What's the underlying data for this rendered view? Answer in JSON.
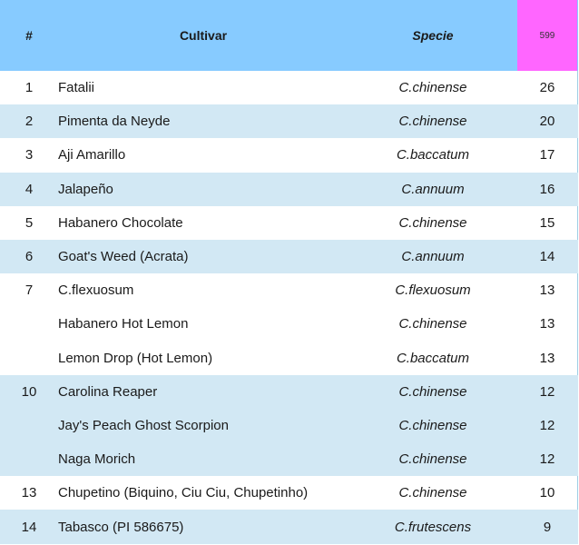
{
  "header": {
    "rank": "#",
    "cultivar": "Cultivar",
    "species": "Specie",
    "total": "599"
  },
  "rows": [
    {
      "rank": "1",
      "cultivar": "Fatalii",
      "species": "C.chinense",
      "count": "26",
      "shaded": false
    },
    {
      "rank": "2",
      "cultivar": "Pimenta da Neyde",
      "species": "C.chinense",
      "count": "20",
      "shaded": true
    },
    {
      "rank": "3",
      "cultivar": "Aji Amarillo",
      "species": "C.baccatum",
      "count": "17",
      "shaded": false
    },
    {
      "rank": "4",
      "cultivar": "Jalapeño",
      "species": "C.annuum",
      "count": "16",
      "shaded": true
    },
    {
      "rank": "5",
      "cultivar": "Habanero Chocolate",
      "species": "C.chinense",
      "count": "15",
      "shaded": false
    },
    {
      "rank": "6",
      "cultivar": "Goat's Weed (Acrata)",
      "species": "C.annuum",
      "count": "14",
      "shaded": true
    },
    {
      "rank": "7",
      "cultivar": "C.flexuosum",
      "species": "C.flexuosum",
      "count": "13",
      "shaded": false
    },
    {
      "rank": "",
      "cultivar": "Habanero Hot Lemon",
      "species": "C.chinense",
      "count": "13",
      "shaded": false
    },
    {
      "rank": "",
      "cultivar": "Lemon Drop (Hot Lemon)",
      "species": "C.baccatum",
      "count": "13",
      "shaded": false
    },
    {
      "rank": "10",
      "cultivar": "Carolina Reaper",
      "species": "C.chinense",
      "count": "12",
      "shaded": true
    },
    {
      "rank": "",
      "cultivar": "Jay's Peach Ghost Scorpion",
      "species": "C.chinense",
      "count": "12",
      "shaded": true
    },
    {
      "rank": "",
      "cultivar": "Naga Morich",
      "species": "C.chinense",
      "count": "12",
      "shaded": true
    },
    {
      "rank": "13",
      "cultivar": "Chupetino (Biquino, Ciu Ciu, Chupetinho)",
      "species": "C.chinense",
      "count": "10",
      "shaded": false
    },
    {
      "rank": "14",
      "cultivar": "Tabasco (PI 586675)",
      "species": "C.frutescens",
      "count": "9",
      "shaded": true
    }
  ],
  "colors": {
    "header_bg": "#87cbff",
    "total_bg": "#ff66ff",
    "shaded_row_bg": "#d2e8f4"
  }
}
